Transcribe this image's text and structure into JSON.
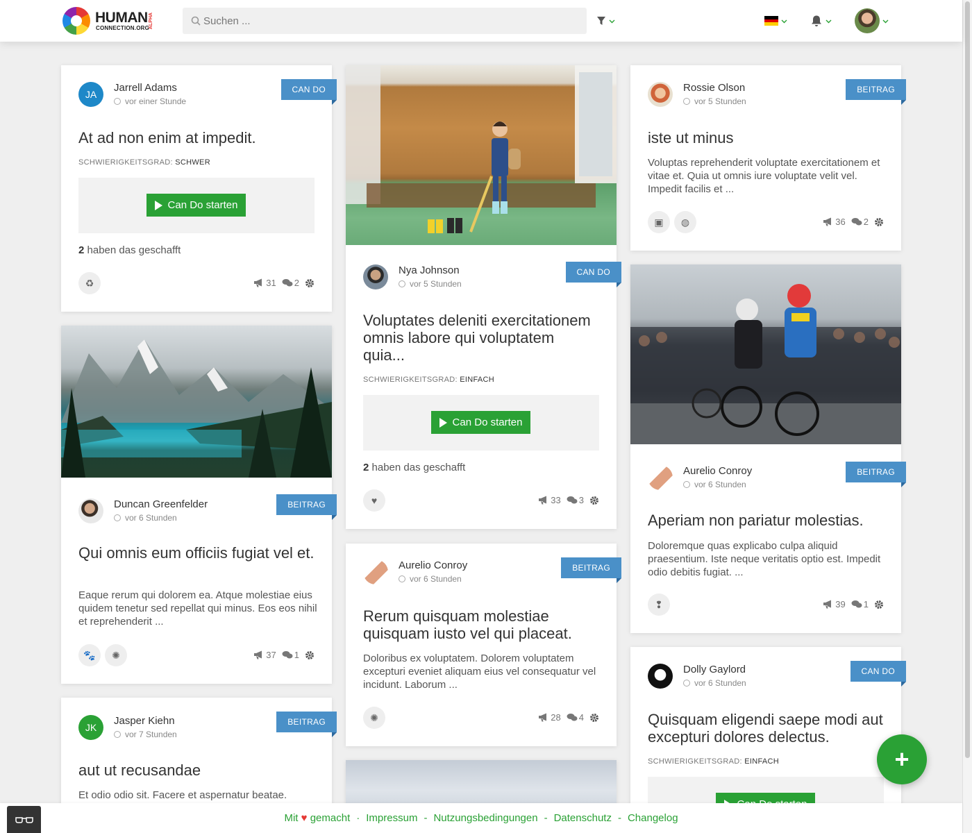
{
  "header": {
    "logo_line1": "HUMAN",
    "logo_line2": "CONNECTION.ORG",
    "logo_badge": "ALPHA",
    "search_placeholder": "Suchen ..."
  },
  "labels": {
    "difficulty_prefix": "SCHWIERIGKEITSGRAD:",
    "cando_button": "Can Do starten",
    "done_suffix": "haben das geschafft"
  },
  "cards": {
    "c1": {
      "author": "Jarrell Adams",
      "initials": "JA",
      "time": "vor einer Stunde",
      "type": "CAN DO",
      "title": "At ad non enim at impedit.",
      "difficulty": "SCHWER",
      "done_count": "2",
      "shouts": "31",
      "comments": "2"
    },
    "c2": {
      "author": "Duncan Greenfelder",
      "time": "vor 6 Stunden",
      "type": "BEITRAG",
      "title": "Qui omnis eum officiis fugiat vel et.",
      "excerpt": "Eaque rerum qui dolorem ea. Atque molestiae eius quidem tenetur sed repellat qui minus. Eos eos nihil et reprehenderit ...",
      "shouts": "37",
      "comments": "1"
    },
    "c3": {
      "author": "Jasper Kiehn",
      "initials": "JK",
      "time": "vor 7 Stunden",
      "type": "BEITRAG",
      "title": "aut ut recusandae",
      "excerpt": "Et odio odio sit. Facere et aspernatur beatae."
    },
    "c4": {
      "author": "Nya Johnson",
      "time": "vor 5 Stunden",
      "type": "CAN DO",
      "title": "Voluptates deleniti exercitationem omnis labore qui voluptatem quia...",
      "difficulty": "EINFACH",
      "done_count": "2",
      "shouts": "33",
      "comments": "3"
    },
    "c5": {
      "author": "Aurelio Conroy",
      "time": "vor 6 Stunden",
      "type": "BEITRAG",
      "title": "Rerum quisquam molestiae quisquam iusto vel qui placeat.",
      "excerpt": "Doloribus ex voluptatem. Dolorem voluptatem excepturi eveniet aliquam eius vel consequatur vel incidunt. Laborum ...",
      "shouts": "28",
      "comments": "4"
    },
    "c6": {
      "author": "Rossie Olson",
      "time": "vor 5 Stunden",
      "type": "BEITRAG",
      "title": "iste ut minus",
      "excerpt": "Voluptas reprehenderit voluptate exercitationem et vitae et. Quia ut omnis iure voluptate velit vel. Impedit facilis et ...",
      "shouts": "36",
      "comments": "2"
    },
    "c7": {
      "author": "Aurelio Conroy",
      "time": "vor 6 Stunden",
      "type": "BEITRAG",
      "title": "Aperiam non pariatur molestias.",
      "excerpt": "Doloremque quas explicabo culpa aliquid praesentium. Iste neque veritatis optio est. Impedit odio debitis fugiat. ...",
      "shouts": "39",
      "comments": "1"
    },
    "c8": {
      "author": "Dolly Gaylord",
      "time": "vor 6 Stunden",
      "type": "CAN DO",
      "title": "Quisquam eligendi saepe modi aut excepturi dolores delectus.",
      "difficulty": "EINFACH"
    }
  },
  "footer": {
    "made_prefix": "Mit",
    "made_suffix": "gemacht",
    "links": [
      "Impressum",
      "Nutzungsbedingungen",
      "Datenschutz",
      "Changelog"
    ]
  },
  "colors": {
    "accent": "#2aa135",
    "ribbon": "#4a90c8",
    "heart": "#e53935"
  },
  "icons": [
    "search-icon",
    "filter-icon",
    "flag-de-icon",
    "bell-icon",
    "clock-icon",
    "play-icon",
    "megaphone-icon",
    "comments-icon",
    "gear-icon",
    "plus-icon",
    "glasses-icon"
  ]
}
